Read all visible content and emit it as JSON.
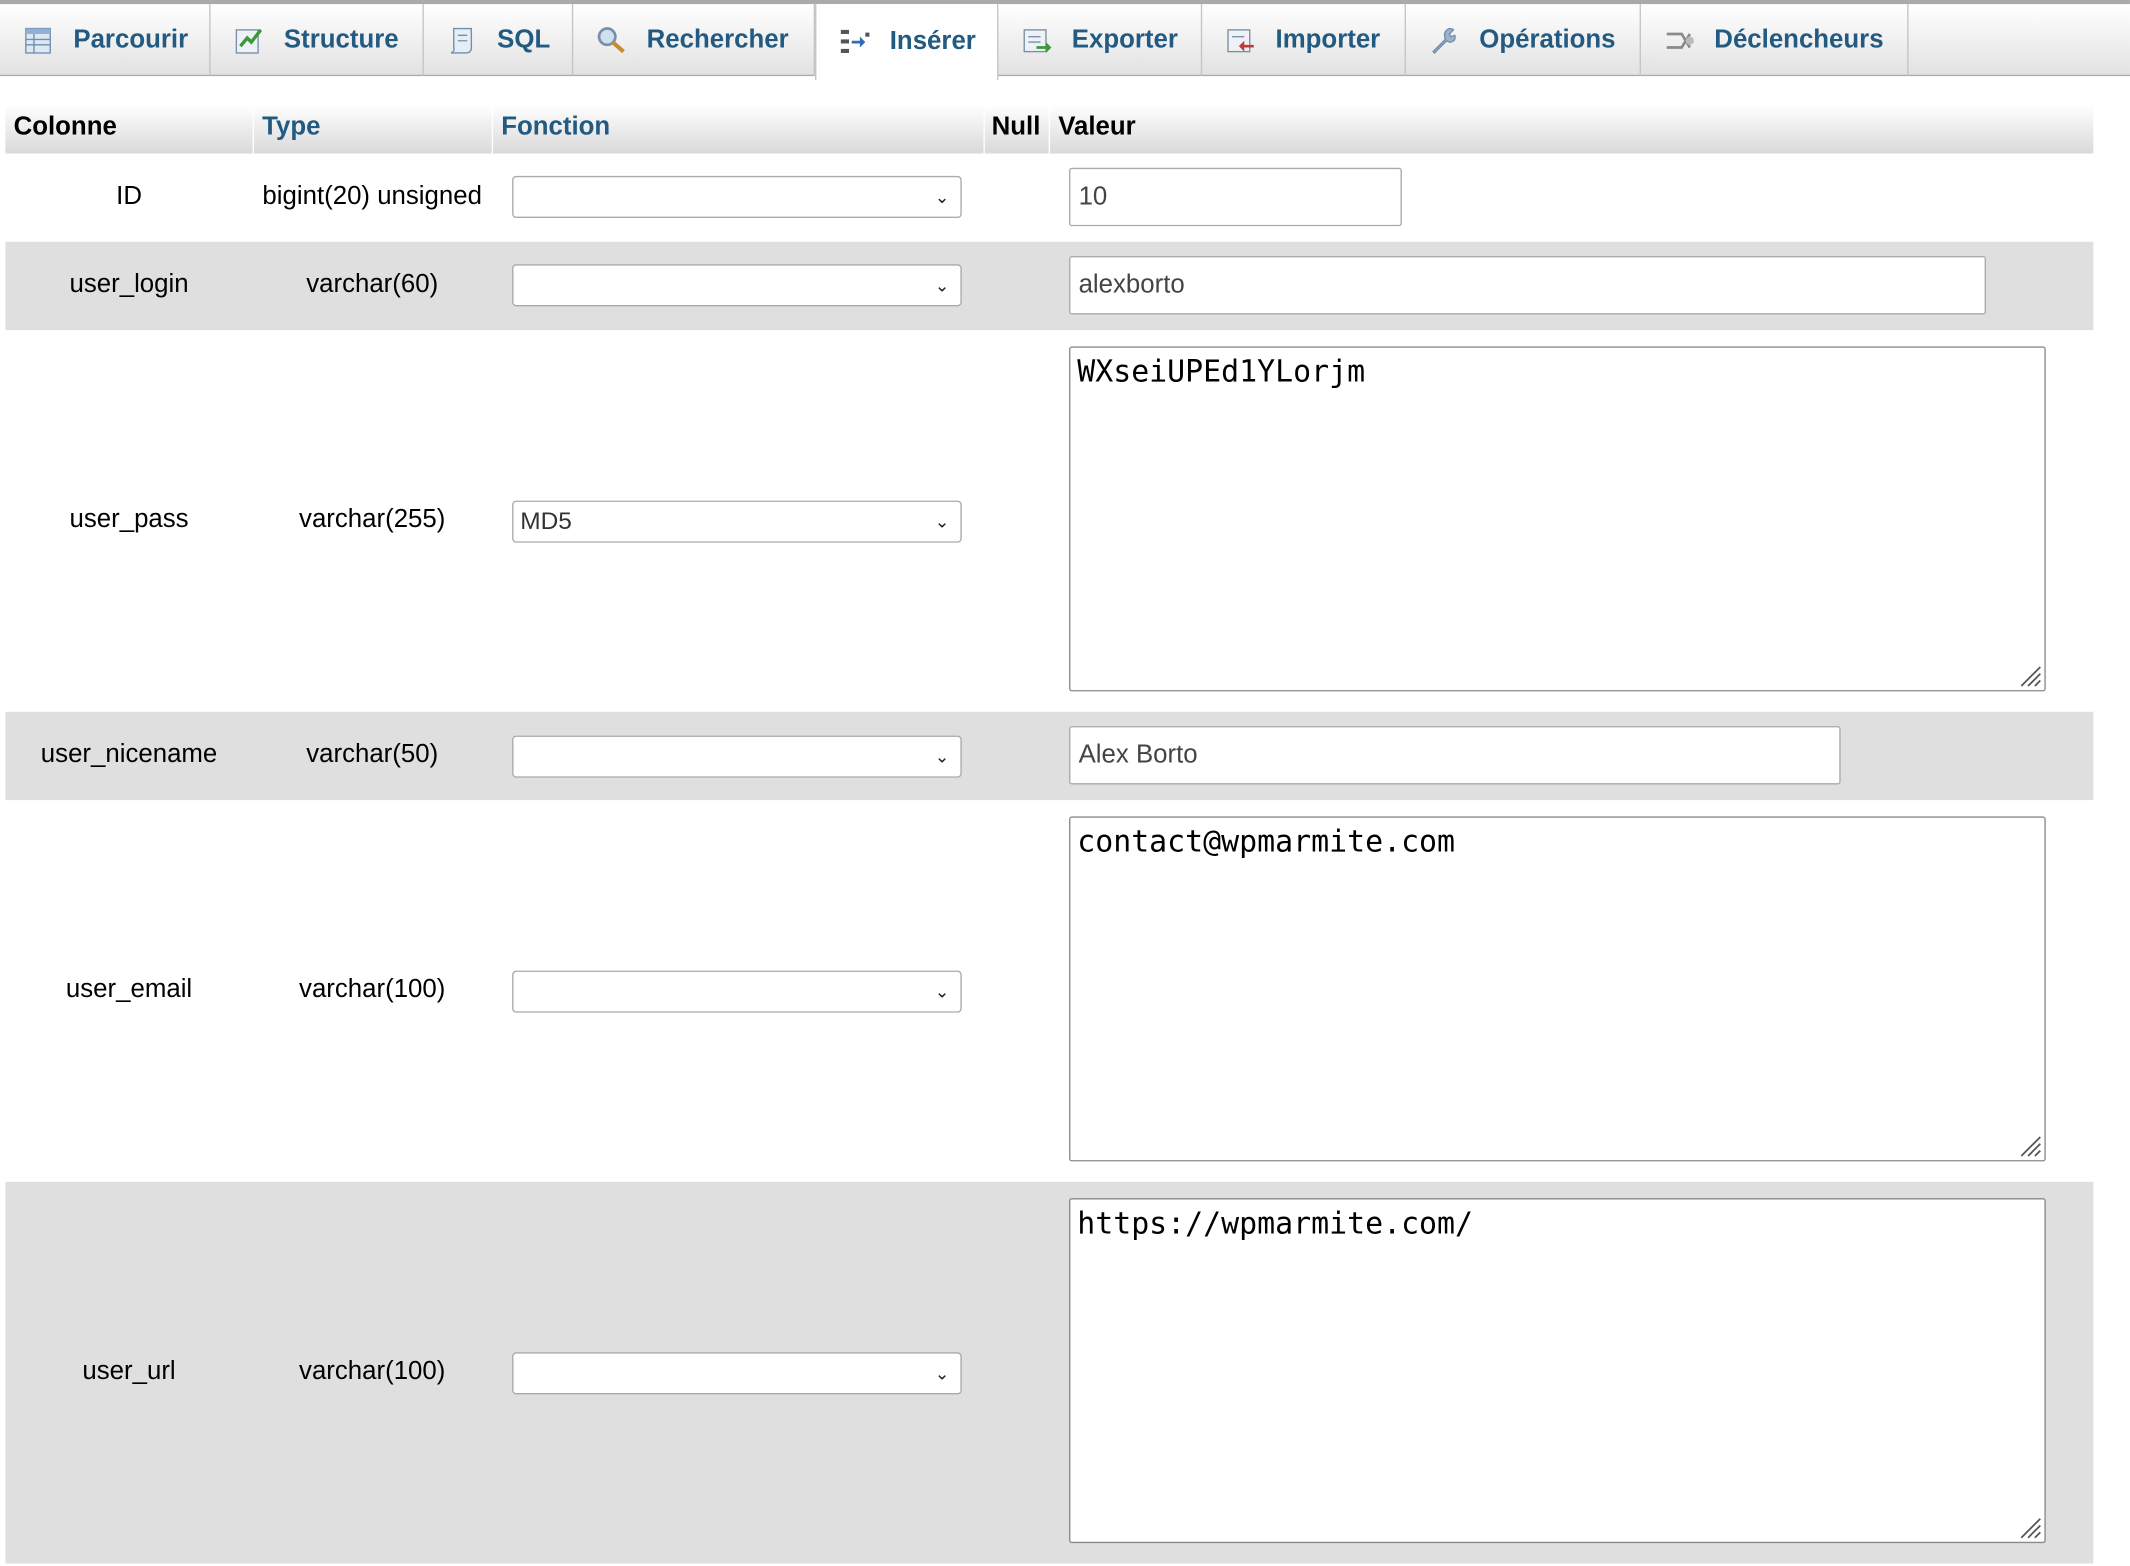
{
  "tabs": [
    {
      "label": "Parcourir",
      "icon": "table-browse-icon"
    },
    {
      "label": "Structure",
      "icon": "structure-icon"
    },
    {
      "label": "SQL",
      "icon": "sql-scroll-icon"
    },
    {
      "label": "Rechercher",
      "icon": "search-magnifier-icon"
    },
    {
      "label": "Insérer",
      "icon": "insert-row-icon"
    },
    {
      "label": "Exporter",
      "icon": "export-icon"
    },
    {
      "label": "Importer",
      "icon": "import-icon"
    },
    {
      "label": "Opérations",
      "icon": "wrench-icon"
    },
    {
      "label": "Déclencheurs",
      "icon": "triggers-icon"
    }
  ],
  "active_tab": "Insérer",
  "header": {
    "colonne": "Colonne",
    "type": "Type",
    "fonction": "Fonction",
    "null": "Null",
    "valeur": "Valeur"
  },
  "rows": [
    {
      "column": "ID",
      "type": "bigint(20) unsigned",
      "function": "",
      "value": "10"
    },
    {
      "column": "user_login",
      "type": "varchar(60)",
      "function": "",
      "value": "alexborto"
    },
    {
      "column": "user_pass",
      "type": "varchar(255)",
      "function": "MD5",
      "value": "WXseiUPEd1YLorjm"
    },
    {
      "column": "user_nicename",
      "type": "varchar(50)",
      "function": "",
      "value": "Alex Borto"
    },
    {
      "column": "user_email",
      "type": "varchar(100)",
      "function": "",
      "value": "contact@wpmarmite.com"
    },
    {
      "column": "user_url",
      "type": "varchar(100)",
      "function": "",
      "value": "https://wpmarmite.com/"
    }
  ],
  "colors": {
    "link": "#235a81",
    "row_alt": "#dfdfdf"
  }
}
